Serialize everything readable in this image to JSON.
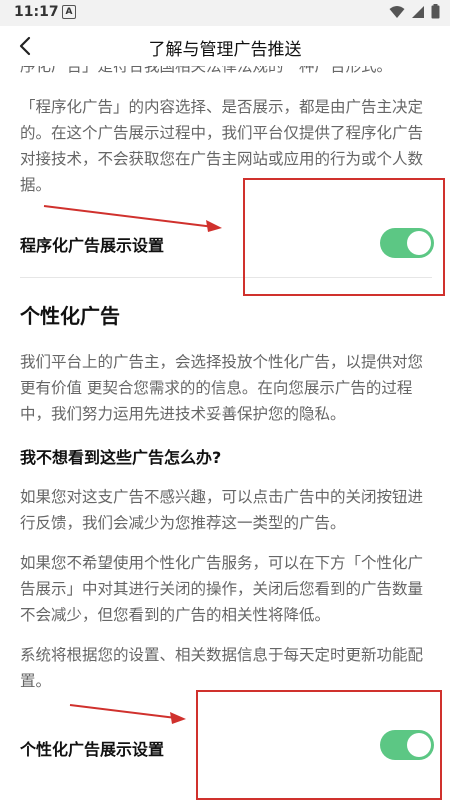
{
  "status_bar": {
    "time": "11:17",
    "notification_icon": "a-box-icon",
    "icons": [
      "wifi-icon",
      "signal-icon",
      "battery-icon"
    ]
  },
  "header": {
    "title": "了解与管理广告推送",
    "back_icon": "chevron-left-icon"
  },
  "content": {
    "cut_top_text": "序化广告」是符合我国相关法律法规的一种广告形式。",
    "programmatic_paragraph": "「程序化广告」的内容选择、是否展示，都是由广告主决定的。在这个广告展示过程中，我们平台仅提供了程序化广告对接技术，不会获取您在广告主网站或应用的行为或个人数据。",
    "programmatic_setting": {
      "label": "程序化广告展示设置",
      "enabled": true
    },
    "personalized_title": "个性化广告",
    "personalized_paragraph": "我们平台上的广告主，会选择投放个性化广告，以提供对您更有价值 更契合您需求的的信息。在向您展示广告的过程中，我们努力运用先进技术妥善保护您的隐私。",
    "faq_title": "我不想看到这些广告怎么办?",
    "faq_paragraph_1": "如果您对这支广告不感兴趣，可以点击广告中的关闭按钮进行反馈，我们会减少为您推荐这一类型的广告。",
    "faq_paragraph_2": "如果您不希望使用个性化广告服务，可以在下方「个性化广告展示」中对其进行关闭的操作，关闭后您看到的广告数量不会减少，但您看到的广告的相关性将降低。",
    "faq_paragraph_3": "系统将根据您的设置、相关数据信息于每天定时更新功能配置。",
    "personalized_setting": {
      "label": "个性化广告展示设置",
      "enabled": true
    }
  },
  "colors": {
    "toggle_on": "#5cc784",
    "annotation_red": "#d0312d"
  }
}
